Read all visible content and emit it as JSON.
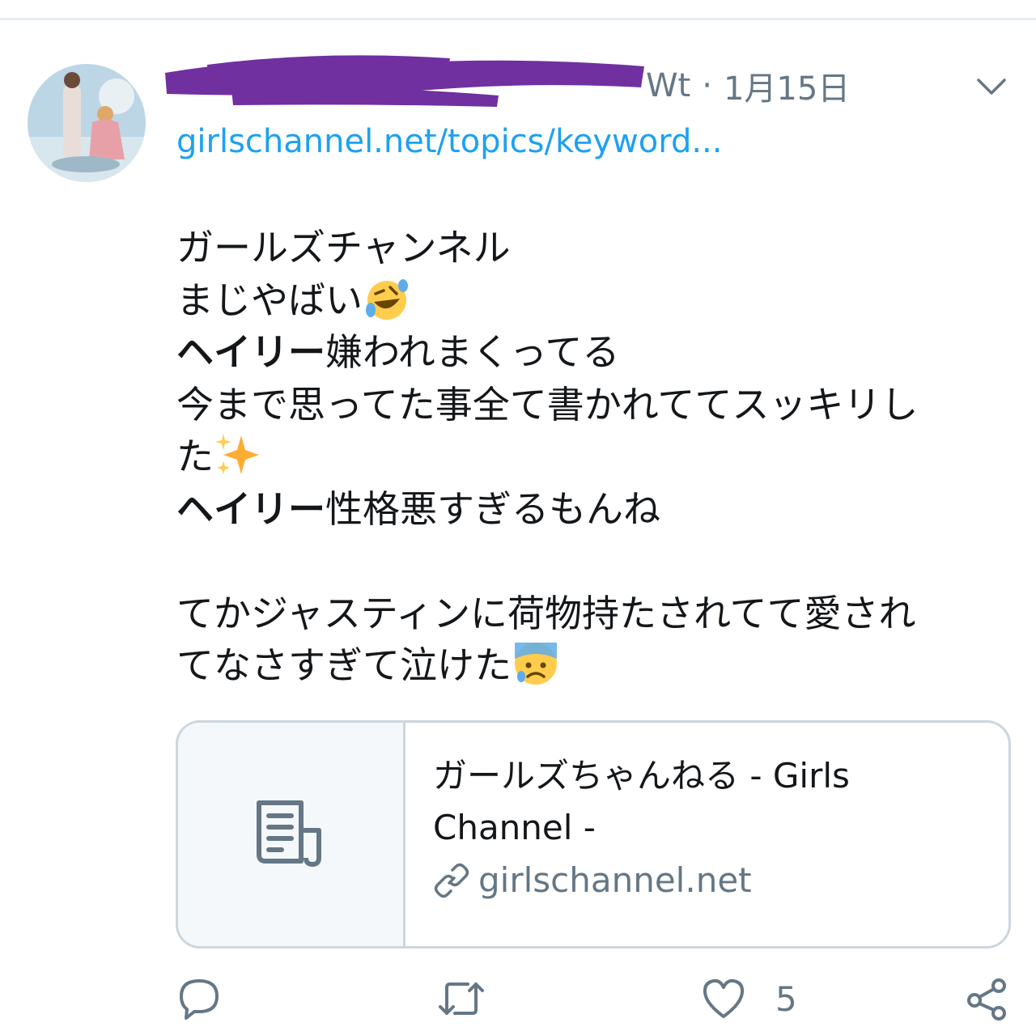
{
  "tweet": {
    "handle_visible": "Wt",
    "separator": "·",
    "date": "1月15日",
    "link": "girlschannel.net/topics/keyword...",
    "text_lines": {
      "l1": "ガールズチャンネル",
      "l2": "まじやばい",
      "l3_bold": "ヘイリー",
      "l3": "嫌われまくってる",
      "l4": "今まで思ってた事全て書かれててスッキリし",
      "l5": "た",
      "l6_bold": "ヘイリー",
      "l6": "性格悪すぎるもんね",
      "l8": "てかジャスティンに荷物持たされてて愛され",
      "l9": "てなさすぎて泣けた"
    }
  },
  "card": {
    "title_line1": "ガールズちゃんねる - Girls",
    "title_line2": "Channel -",
    "domain": "girlschannel.net"
  },
  "actions": {
    "like_count": "5"
  },
  "colors": {
    "link": "#1da1f2",
    "secondary_text": "#657786",
    "border": "#ccd6dd",
    "redaction": "#7030a0"
  }
}
